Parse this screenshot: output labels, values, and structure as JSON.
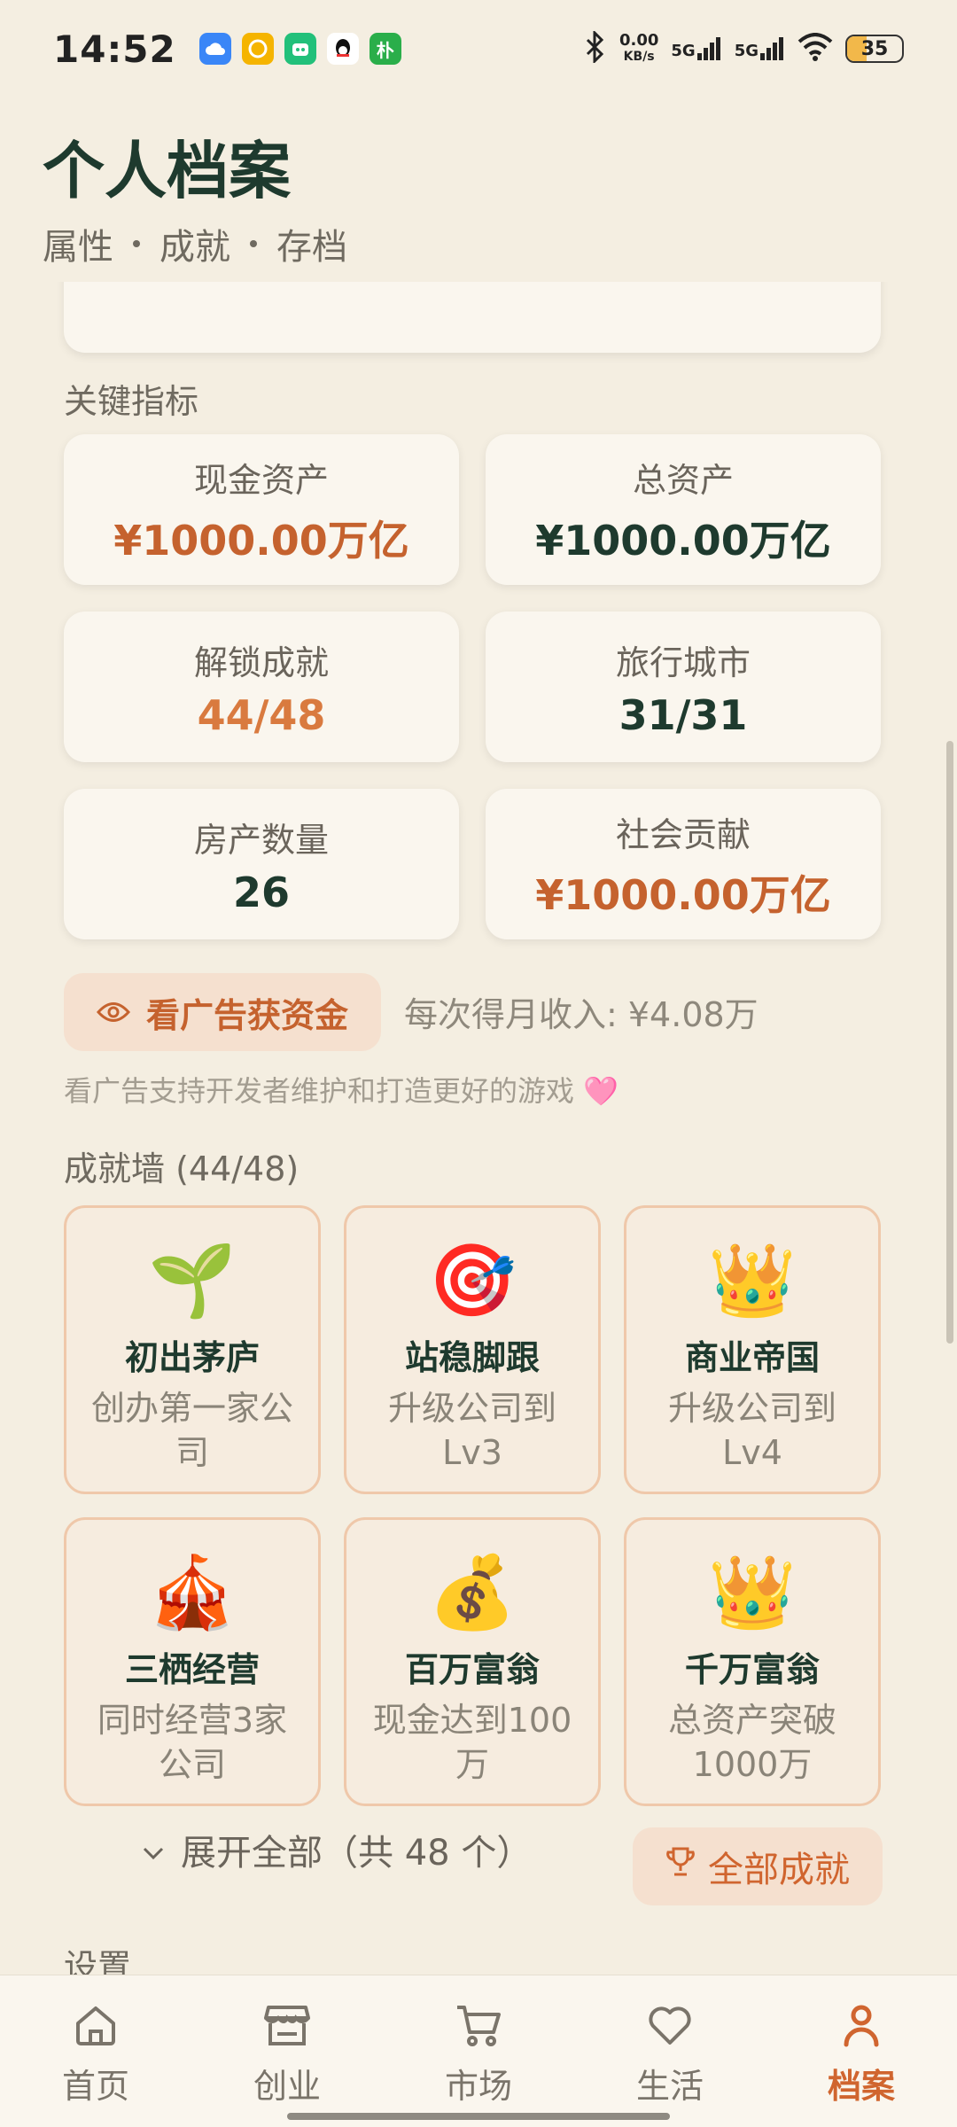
{
  "status_bar": {
    "time": "14:52",
    "app_icons": [
      {
        "name": "cloud-app-icon",
        "color": "#3A86F7",
        "glyph": ""
      },
      {
        "name": "coin-app-icon",
        "color": "#F5B400",
        "glyph": ""
      },
      {
        "name": "cat-app-icon",
        "color": "#22C07A",
        "glyph": ""
      },
      {
        "name": "qq-app-icon",
        "color": "#FFFFFF",
        "glyph": ""
      },
      {
        "name": "pdd-app-icon",
        "color": "#2AAE4A",
        "glyph": "朴"
      }
    ],
    "net_speed_value": "0.00",
    "net_speed_unit": "KB/s",
    "signal_1": "5G",
    "signal_2": "5G",
    "battery": "35",
    "battery_level": 0.35
  },
  "header": {
    "title": "个人档案",
    "subtitle_parts": [
      "属性",
      "成就",
      "存档"
    ]
  },
  "key_metrics": {
    "section_label": "关键指标",
    "items": [
      {
        "label": "现金资产",
        "value": "¥1000.00万亿",
        "color": "#C5622E"
      },
      {
        "label": "总资产",
        "value": "¥1000.00万亿",
        "color": "#1E3A2E"
      },
      {
        "label": "解锁成就",
        "value": "44/48",
        "color": "#D97A3F"
      },
      {
        "label": "旅行城市",
        "value": "31/31",
        "color": "#1E3A2E"
      },
      {
        "label": "房产数量",
        "value": "26",
        "color": "#1E3A2E"
      },
      {
        "label": "社会贡献",
        "value": "¥1000.00万亿",
        "color": "#C5622E"
      }
    ]
  },
  "ad": {
    "button_label": "看广告获资金",
    "income_text": "每次得月收入: ¥4.08万",
    "note": "看广告支持开发者维护和打造更好的游戏 🩷"
  },
  "achievements": {
    "section_label": "成就墙 (44/48)",
    "items": [
      {
        "emoji": "🌱",
        "icon_name": "seedling-icon",
        "name": "初出茅庐",
        "desc": "创办第一家公司"
      },
      {
        "emoji": "🎯",
        "icon_name": "target-icon",
        "name": "站稳脚跟",
        "desc": "升级公司到Lv3"
      },
      {
        "emoji": "👑",
        "icon_name": "crown-icon",
        "name": "商业帝国",
        "desc": "升级公司到Lv4"
      },
      {
        "emoji": "🎪",
        "icon_name": "circus-tent-icon",
        "name": "三栖经营",
        "desc": "同时经营3家公司"
      },
      {
        "emoji": "💰",
        "icon_name": "money-bag-icon",
        "name": "百万富翁",
        "desc": "现金达到100万"
      },
      {
        "emoji": "👑",
        "icon_name": "crown-icon",
        "name": "千万富翁",
        "desc": "总资产突破1000万"
      }
    ],
    "expand_label": "展开全部（共 48 个）",
    "all_button_label": "全部成就"
  },
  "settings": {
    "section_label": "设置"
  },
  "bottom_nav": {
    "items": [
      {
        "label": "首页",
        "icon": "home-icon"
      },
      {
        "label": "创业",
        "icon": "shop-icon"
      },
      {
        "label": "市场",
        "icon": "cart-icon"
      },
      {
        "label": "生活",
        "icon": "heart-icon"
      },
      {
        "label": "档案",
        "icon": "person-icon",
        "active": true
      }
    ]
  },
  "colors": {
    "background": "#F4EEE1",
    "accent": "#D0652F",
    "dark_green": "#1E3A2E"
  }
}
